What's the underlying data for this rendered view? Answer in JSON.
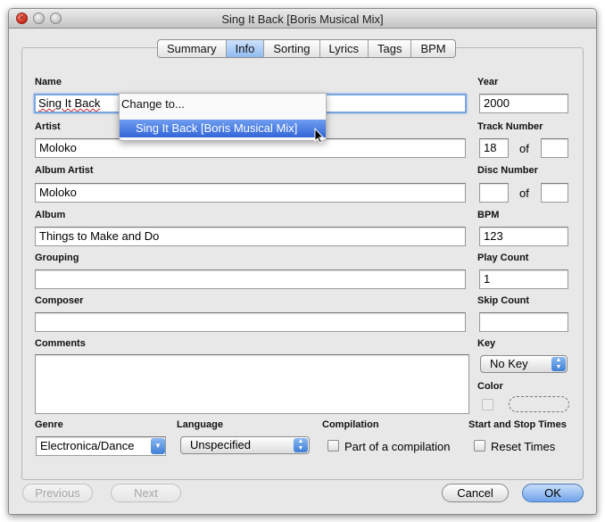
{
  "window": {
    "title": "Sing It Back [Boris Musical Mix]"
  },
  "tabs": [
    "Summary",
    "Info",
    "Sorting",
    "Lyrics",
    "Tags",
    "BPM"
  ],
  "fields": {
    "name": {
      "label": "Name",
      "value": "Sing It Back"
    },
    "artist": {
      "label": "Artist",
      "value": "Moloko"
    },
    "album_artist": {
      "label": "Album Artist",
      "value": "Moloko"
    },
    "album": {
      "label": "Album",
      "value": "Things to Make and Do"
    },
    "grouping": {
      "label": "Grouping",
      "value": ""
    },
    "composer": {
      "label": "Composer",
      "value": ""
    },
    "comments": {
      "label": "Comments",
      "value": ""
    },
    "year": {
      "label": "Year",
      "value": "2000"
    },
    "track_number": {
      "label": "Track Number",
      "value": "18",
      "of_label": "of",
      "of_value": ""
    },
    "disc_number": {
      "label": "Disc Number",
      "value": "",
      "of_label": "of",
      "of_value": ""
    },
    "bpm": {
      "label": "BPM",
      "value": "123"
    },
    "play_count": {
      "label": "Play Count",
      "value": "1"
    },
    "skip_count": {
      "label": "Skip Count",
      "value": ""
    },
    "key": {
      "label": "Key",
      "value": "No Key"
    },
    "color": {
      "label": "Color"
    },
    "genre": {
      "label": "Genre",
      "value": "Electronica/Dance"
    },
    "language": {
      "label": "Language",
      "value": "Unspecified"
    },
    "compilation": {
      "label": "Compilation",
      "checkbox_label": "Part of a compilation",
      "checked": false
    },
    "start_stop": {
      "label": "Start and Stop Times",
      "checkbox_label": "Reset Times",
      "checked": false
    }
  },
  "autocomplete_menu": {
    "header": "Change to...",
    "items": [
      "Sing It Back [Boris Musical Mix]"
    ]
  },
  "buttons": {
    "previous": "Previous",
    "next": "Next",
    "cancel": "Cancel",
    "ok": "OK"
  }
}
